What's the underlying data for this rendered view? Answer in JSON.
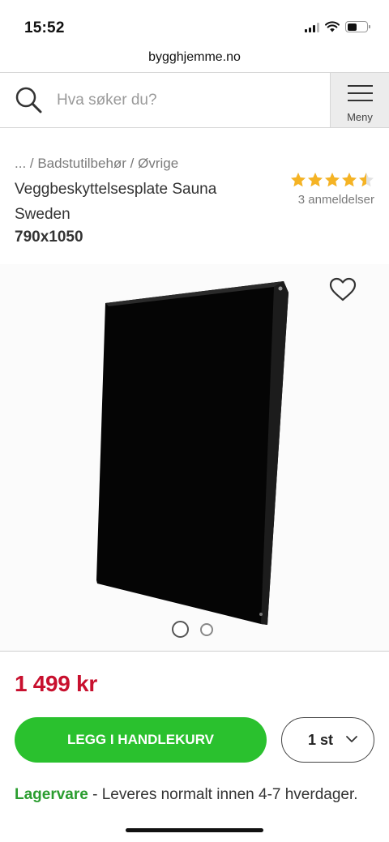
{
  "status_bar": {
    "time": "15:52"
  },
  "browser": {
    "url": "bygghjemme.no"
  },
  "header": {
    "search_placeholder": "Hva søker du?",
    "menu_label": "Meny"
  },
  "product": {
    "breadcrumb": "... / Badstutilbehør / Øvrige",
    "title": "Veggbeskyttelsesplate Sauna Sweden",
    "variant": "790x1050",
    "rating": {
      "stars": 4.5,
      "max": 5,
      "review_count": "3 anmeldelser"
    },
    "price": "1 499 kr",
    "add_to_cart_label": "LEGG I HANDLEKURV",
    "quantity": "1 st",
    "stock_status": "Lagervare",
    "delivery_text": " - Leveres normalt innen 4-7 hverdager.",
    "image_count": 2,
    "active_image": 1
  },
  "colors": {
    "price": "#c8102e",
    "cta": "#2ac12e",
    "stock": "#2a9d2f",
    "star": "#f5b324"
  }
}
